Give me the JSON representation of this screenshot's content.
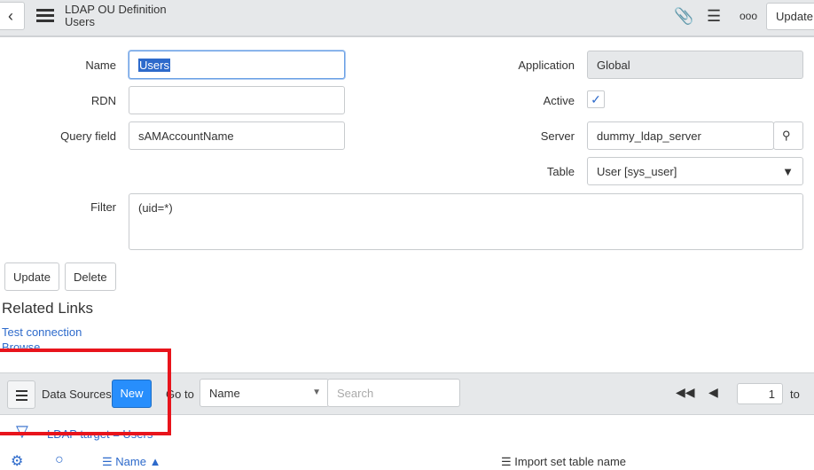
{
  "header": {
    "title": "LDAP OU Definition",
    "subtitle": "Users",
    "update_label": "Update"
  },
  "form": {
    "name_label": "Name",
    "name_value": "Users",
    "rdn_label": "RDN",
    "rdn_value": "",
    "query_label": "Query field",
    "query_value": "sAMAccountName",
    "filter_label": "Filter",
    "filter_value": "(uid=*)",
    "application_label": "Application",
    "application_value": "Global",
    "active_label": "Active",
    "active_checked": true,
    "server_label": "Server",
    "server_value": "dummy_ldap_server",
    "table_label": "Table",
    "table_value": "User [sys_user]",
    "update_label": "Update",
    "delete_label": "Delete"
  },
  "related": {
    "title": "Related Links",
    "links": [
      "Test connection",
      "Browse"
    ]
  },
  "list": {
    "title": "Data Sources",
    "new_label": "New",
    "goto_label": "Go to",
    "goto_field": "Name",
    "search_placeholder": "Search",
    "page": "1",
    "to_label": "to",
    "breadcrumb": "LDAP target = Users",
    "col_name": "Name",
    "col_import": "Import set table name"
  },
  "colors": {
    "accent": "#278efc",
    "annotation": "#e8141c"
  }
}
